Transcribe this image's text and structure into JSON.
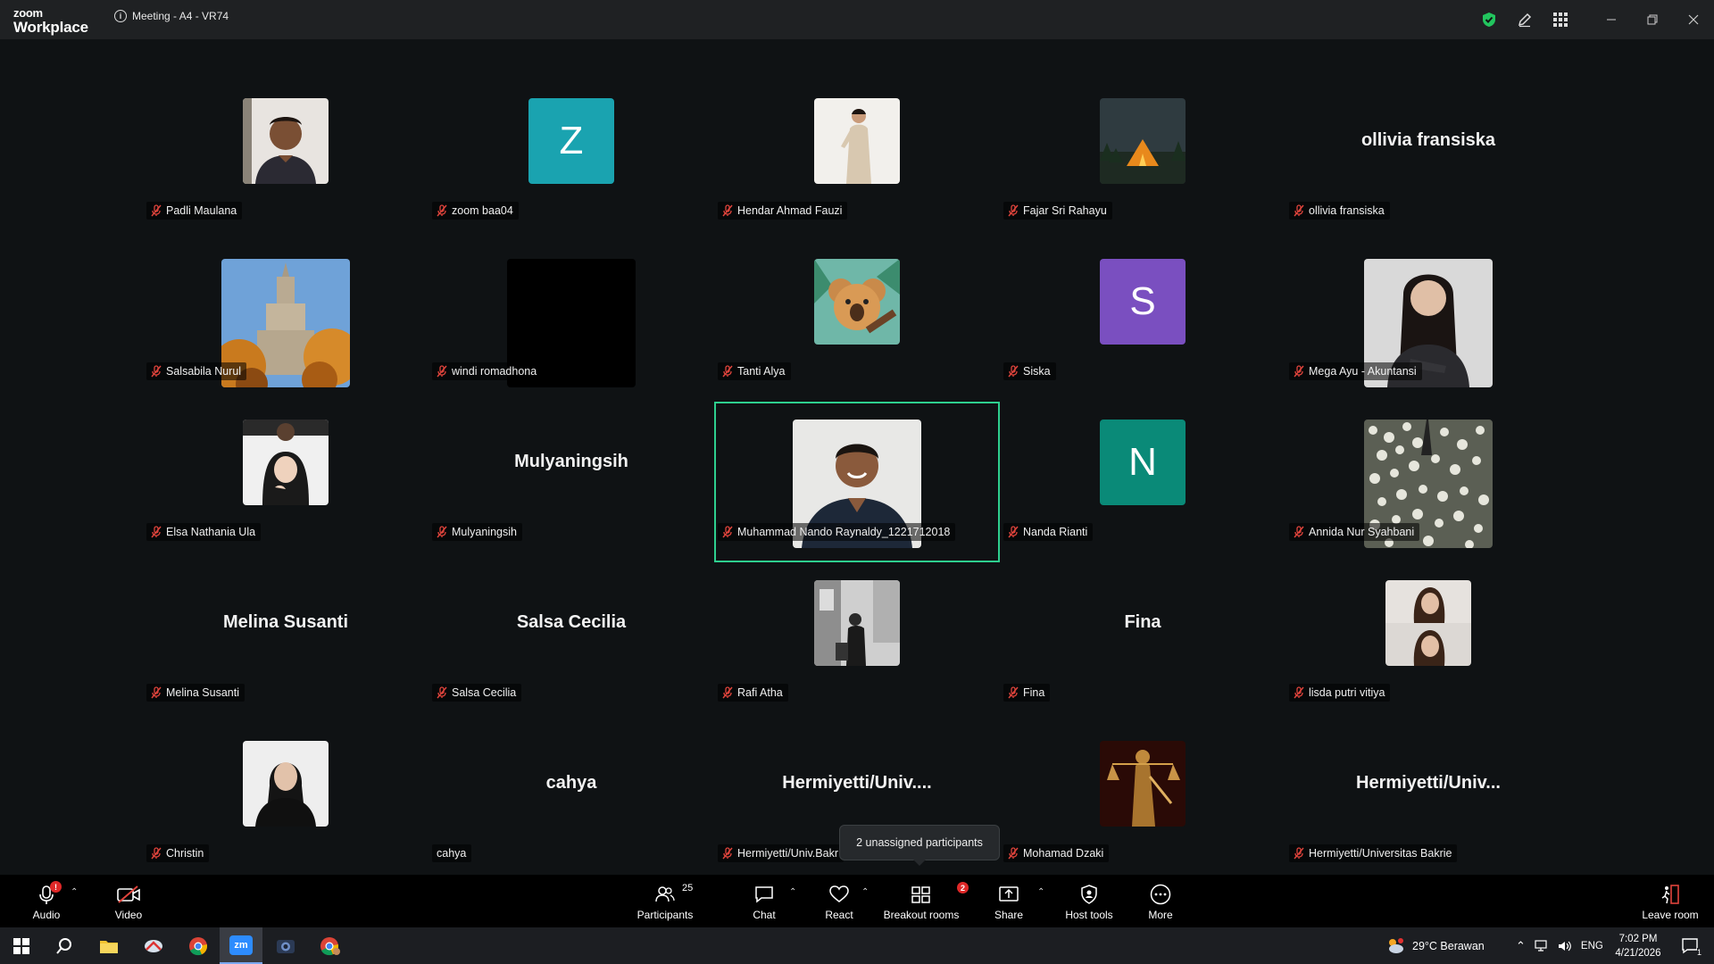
{
  "window": {
    "logo_line1": "zoom",
    "logo_line2": "Workplace",
    "meeting_title": "Meeting - A4 - VR74"
  },
  "participants": [
    {
      "name": "Padli Maulana",
      "kind": "photo",
      "photo": "man-portrait"
    },
    {
      "name": "zoom baa04",
      "kind": "letter",
      "letter": "Z",
      "color": "#1aa3b0"
    },
    {
      "name": "Hendar Ahmad Fauzi",
      "kind": "photo",
      "photo": "man-light-background"
    },
    {
      "name": "Fajar Sri Rahayu",
      "kind": "photo",
      "photo": "tent-night"
    },
    {
      "name": "ollivia fransiska",
      "kind": "text",
      "display": "ollivia fransiska"
    },
    {
      "name": "Salsabila Nurul",
      "kind": "photo-big",
      "photo": "palace-autumn"
    },
    {
      "name": "windi romadhona",
      "kind": "photo-big",
      "photo": "black"
    },
    {
      "name": "Tanti Alya",
      "kind": "photo",
      "photo": "koala-illustration"
    },
    {
      "name": "Siska",
      "kind": "letter",
      "letter": "S",
      "color": "#7a4fc0"
    },
    {
      "name": "Mega Ayu - Akuntansi",
      "kind": "photo-big",
      "photo": "woman-portrait"
    },
    {
      "name": "Elsa Nathania Ula",
      "kind": "photo",
      "photo": "woman-hijab"
    },
    {
      "name": "Mulyaningsih",
      "kind": "text",
      "display": "Mulyaningsih"
    },
    {
      "name": "Muhammad Nando Raynaldy_1221712018",
      "kind": "photo-big",
      "photo": "man-smiling",
      "active": true
    },
    {
      "name": "Nanda Rianti",
      "kind": "letter",
      "letter": "N",
      "color": "#0a8a78"
    },
    {
      "name": "Annida Nur Syahbani",
      "kind": "photo-big",
      "photo": "flowers"
    },
    {
      "name": "Melina Susanti",
      "kind": "text",
      "display": "Melina Susanti"
    },
    {
      "name": "Salsa Cecilia",
      "kind": "text",
      "display": "Salsa Cecilia"
    },
    {
      "name": "Rafi Atha",
      "kind": "photo",
      "photo": "bw-street"
    },
    {
      "name": "Fina",
      "kind": "text",
      "display": "Fina"
    },
    {
      "name": "lisda putri vitiya",
      "kind": "photo",
      "photo": "woman-double"
    },
    {
      "name": "Christin",
      "kind": "photo",
      "photo": "woman-black"
    },
    {
      "name": "cahya",
      "kind": "text",
      "display": "cahya",
      "unmuted": true
    },
    {
      "name": "Hermiyetti/Univ.Bakr",
      "kind": "text",
      "display": "Hermiyetti/Univ...."
    },
    {
      "name": "Mohamad Dzaki",
      "kind": "photo",
      "photo": "justice-statue"
    },
    {
      "name": "Hermiyetti/Universitas Bakrie",
      "kind": "text",
      "display": "Hermiyetti/Univ..."
    }
  ],
  "tooltip": "2 unassigned participants",
  "toolbar": {
    "audio": "Audio",
    "video": "Video",
    "participants": "Participants",
    "participants_count": "25",
    "chat": "Chat",
    "react": "React",
    "breakout": "Breakout rooms",
    "breakout_badge": "2",
    "share": "Share",
    "host_tools": "Host tools",
    "more": "More",
    "leave": "Leave room"
  },
  "taskbar": {
    "weather": "29°C  Berawan",
    "lang": "ENG",
    "time": "7:02 PM",
    "date": "4/21/2026",
    "notif_count": "1"
  },
  "colors": {
    "accent_active": "#2ecf8f",
    "mute_red": "#e0443c",
    "security_green": "#22c55e"
  }
}
